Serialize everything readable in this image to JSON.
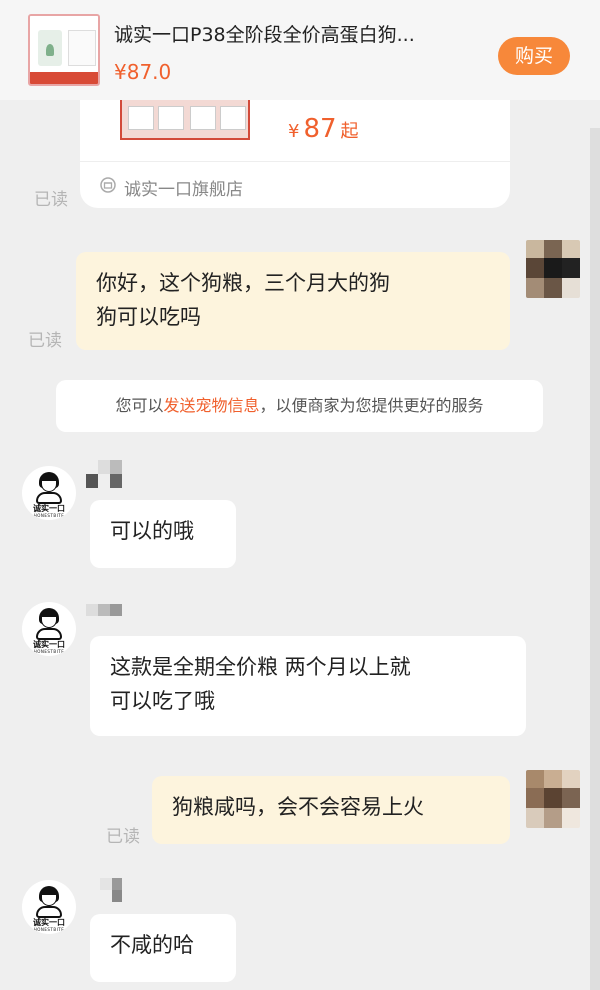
{
  "product": {
    "title": "诚实一口P38全阶段全价高蛋白狗...",
    "price": "¥87.0",
    "buy_label": "购买"
  },
  "product_card": {
    "price_symbol": "¥",
    "price_value": "87",
    "price_suffix": "起",
    "store_name": "诚实一口旗舰店"
  },
  "read_label": "已读",
  "system_tip": {
    "prefix": "您可以",
    "link": "发送宠物信息",
    "suffix": "，以便商家为您提供更好的服务"
  },
  "messages": [
    {
      "from": "me",
      "text": "你好，这个狗粮，三个月大的狗\n狗可以吃吗",
      "status": "已读"
    },
    {
      "from": "shop",
      "text": "可以的哦"
    },
    {
      "from": "shop",
      "text": "这款是全期全价粮 两个月以上就\n可以吃了哦"
    },
    {
      "from": "me",
      "text": "狗粮咸吗，会不会容易上火",
      "status": "已读"
    },
    {
      "from": "shop",
      "text": "不咸的哈"
    }
  ],
  "shop_avatar": {
    "brand": "诚实一口",
    "sub": "HONESTBITE"
  },
  "colors": {
    "accent": "#f0602d",
    "buy_button": "#f7883a",
    "my_bubble": "#fdf4dd",
    "background": "#efefef"
  }
}
